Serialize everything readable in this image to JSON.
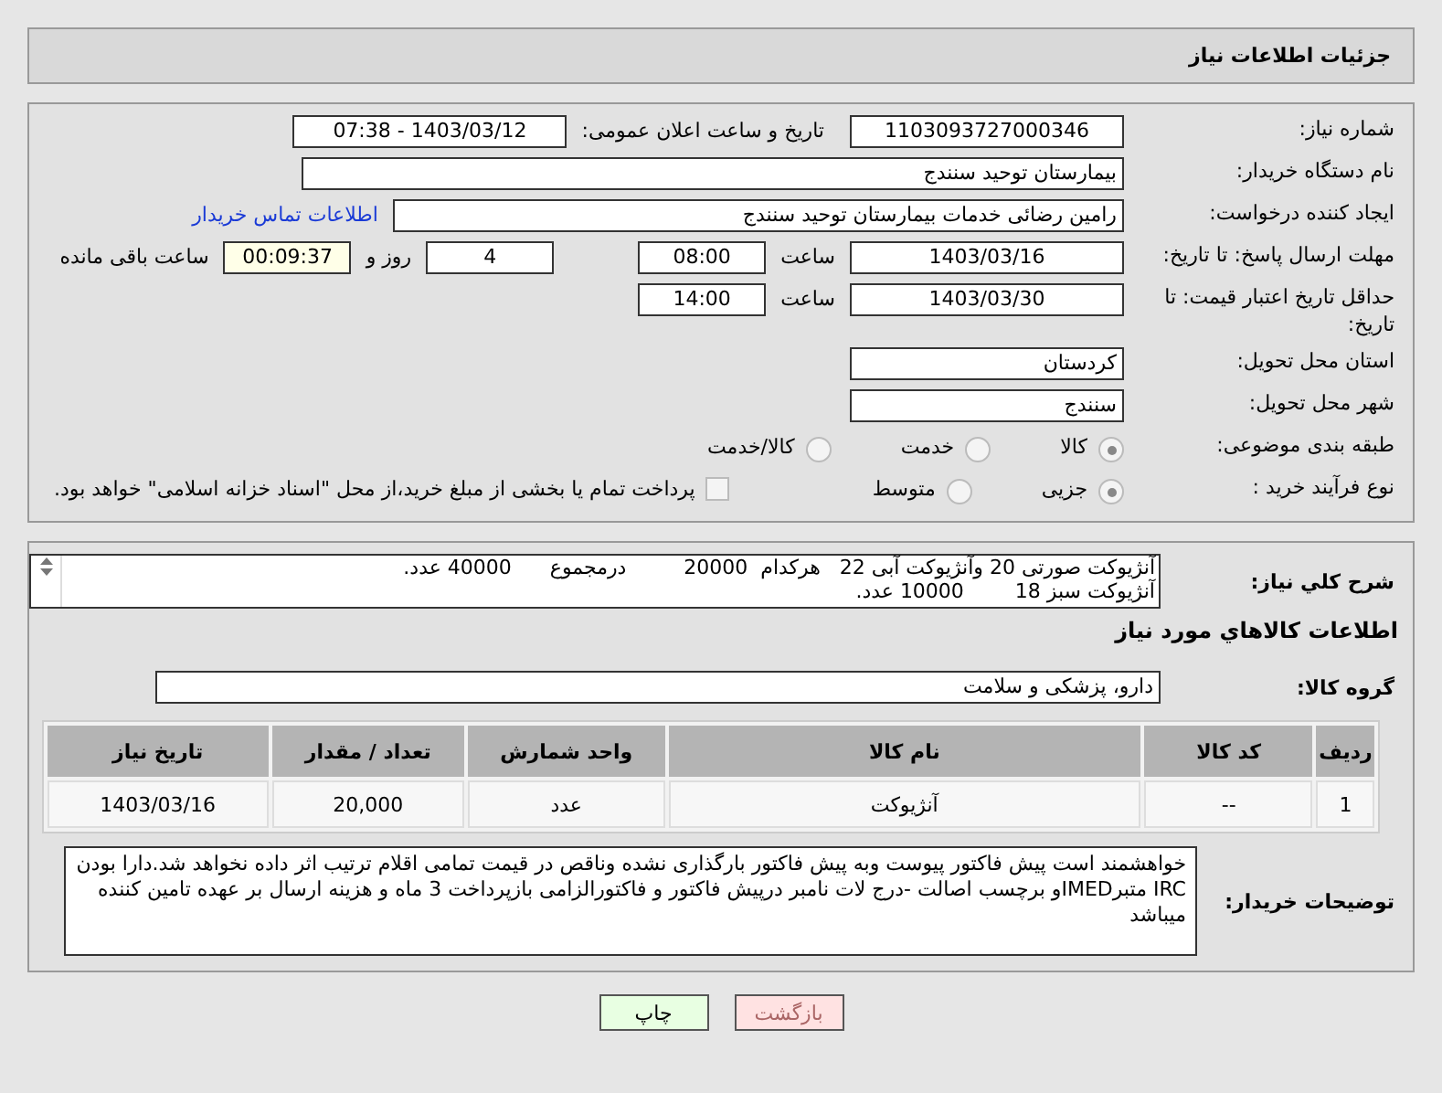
{
  "header": {
    "title": "جزئیات اطلاعات نیاز"
  },
  "form": {
    "need_number": {
      "label": "شماره نیاز:",
      "value": "1103093727000346"
    },
    "announce": {
      "label": "تاریخ و ساعت اعلان عمومی:",
      "value": "1403/03/12 - 07:38"
    },
    "buyer_org": {
      "label": "نام دستگاه خریدار:",
      "value": "بیمارستان توحید سنندج"
    },
    "requester": {
      "label": "ایجاد کننده درخواست:",
      "value": "رامین رضائی خدمات بیمارستان توحید سنندج",
      "link": "اطلاعات تماس خریدار"
    },
    "response_deadline": {
      "label": "مهلت ارسال پاسخ: تا تاریخ:",
      "date": "1403/03/16",
      "time_label": "ساعت",
      "time": "08:00",
      "days": "4",
      "days_label": "روز و",
      "remaining": "00:09:37",
      "remaining_label": "ساعت باقی مانده"
    },
    "price_validity": {
      "label": "حداقل تاریخ اعتبار قیمت: تا تاریخ:",
      "date": "1403/03/30",
      "time_label": "ساعت",
      "time": "14:00"
    },
    "province": {
      "label": "استان محل تحویل:",
      "value": "کردستان"
    },
    "city": {
      "label": "شهر محل تحویل:",
      "value": "سنندج"
    },
    "category": {
      "label": "طبقه بندی موضوعی:",
      "options": [
        {
          "label": "کالا",
          "selected": true
        },
        {
          "label": "خدمت",
          "selected": false
        },
        {
          "label": "کالا/خدمت",
          "selected": false
        }
      ]
    },
    "process": {
      "label": "نوع فرآیند خرید :",
      "options": [
        {
          "label": "جزیی",
          "selected": true
        },
        {
          "label": "متوسط",
          "selected": false
        }
      ],
      "checkbox": {
        "label": "پرداخت تمام یا بخشی از مبلغ خرید،از محل \"اسناد خزانه اسلامی\" خواهد بود.",
        "checked": false
      }
    }
  },
  "needs": {
    "summary": {
      "label": "شرح کلي نياز:",
      "lines": [
        "آنژیوکت صورتی 20 وآنژیوکت آبی 22   هرکدام  20000         درمجموع      40000 عدد.",
        "آنژیوکت سبز 18        10000 عدد."
      ]
    },
    "goods_title": "اطلاعات کالاهاي مورد نياز",
    "group": {
      "label": "گروه کالا:",
      "value": "دارو، پزشکی و سلامت"
    },
    "table": {
      "columns": [
        "ردیف",
        "کد کالا",
        "نام کالا",
        "واحد شمارش",
        "تعداد / مقدار",
        "تاریخ نیاز"
      ],
      "rows": [
        [
          "1",
          "--",
          "آنژیوکت",
          "عدد",
          "20,000",
          "1403/03/16"
        ]
      ]
    },
    "buyer_notes": {
      "label": "توضیحات خریدار:",
      "value": "خواهشمند است پیش فاکتور پیوست وبه پیش فاکتور بارگذاری نشده وناقص در قیمت تمامی اقلام ترتیب اثر داده نخواهد شد.دارا بودن IRC متبرIMEDو برچسب اصالت -درج لات نامبر درپیش فاکتور و فاکتورالزامی  بازپرداخت 3 ماه و هزینه ارسال بر عهده تامین کننده میباشد"
    }
  },
  "buttons": [
    {
      "label": "بازگشت",
      "kind": "back"
    },
    {
      "label": "چاپ",
      "kind": "print"
    }
  ]
}
